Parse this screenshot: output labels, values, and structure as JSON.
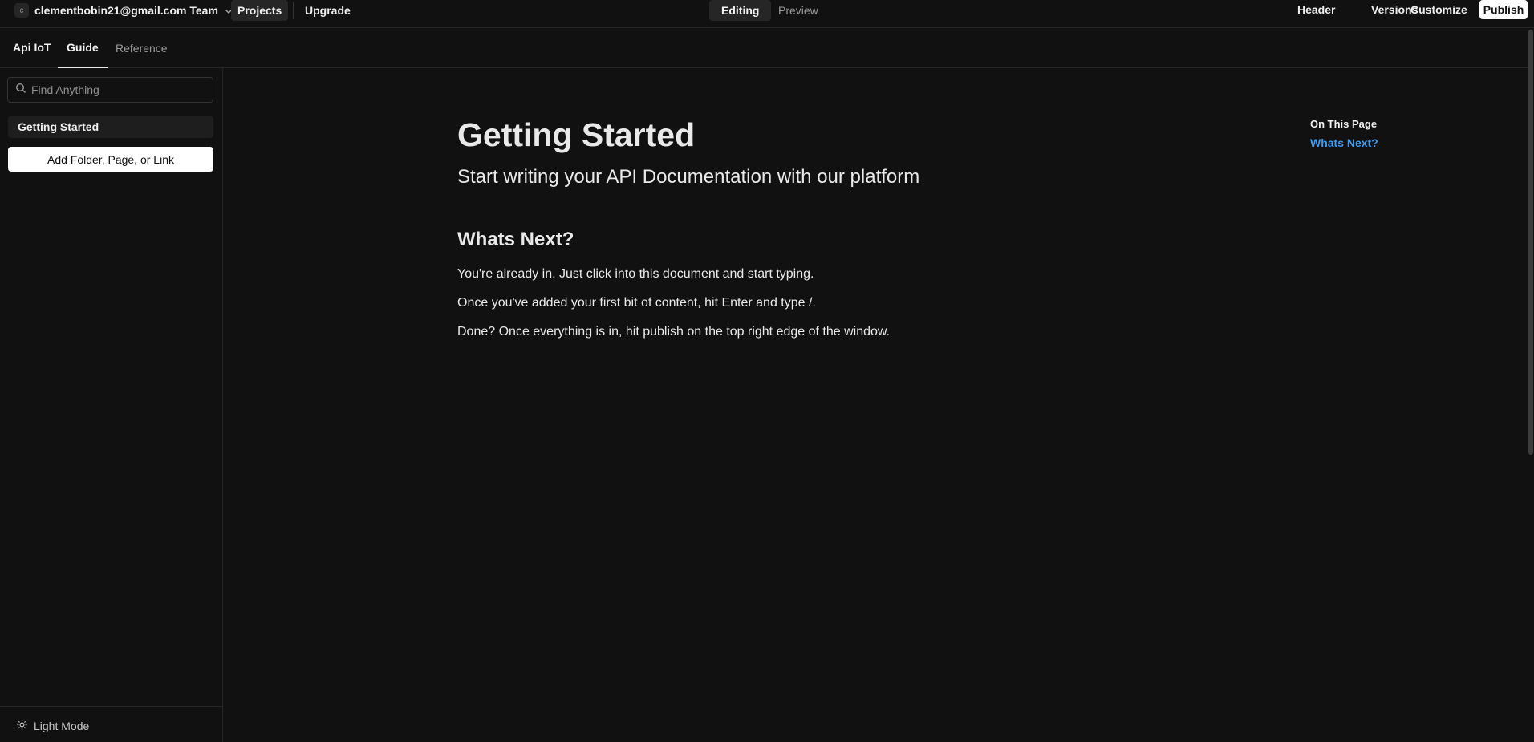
{
  "topbar": {
    "team_avatar": "c",
    "team_label": "clementbobin21@gmail.com Team",
    "projects": "Projects",
    "upgrade": "Upgrade",
    "editing": "Editing",
    "preview": "Preview",
    "header": "Header",
    "versions": "Versions",
    "customize": "Customize",
    "publish": "Publish"
  },
  "subbar": {
    "project_name": "Api IoT",
    "tabs": [
      {
        "label": "Guide",
        "active": true
      },
      {
        "label": "Reference",
        "active": false
      }
    ]
  },
  "sidebar": {
    "search_placeholder": "Find Anything",
    "pages": [
      {
        "label": "Getting Started",
        "active": true
      }
    ],
    "add_button": "Add Folder, Page, or Link",
    "footer_toggle": "Light Mode"
  },
  "content": {
    "title": "Getting Started",
    "subtitle": "Start writing your API Documentation with our platform",
    "section_heading": "Whats Next?",
    "paragraphs": [
      "You're already in. Just click into this document and start typing.",
      "Once you've added your first bit of content, hit Enter and type /.",
      "Done? Once everything is in, hit publish on the top right edge of the window."
    ]
  },
  "toc": {
    "title": "On This Page",
    "links": [
      "Whats Next?"
    ]
  },
  "colors": {
    "background": "#111111",
    "accent_link": "#3d9cf0",
    "publish_button": "#ffffff"
  }
}
